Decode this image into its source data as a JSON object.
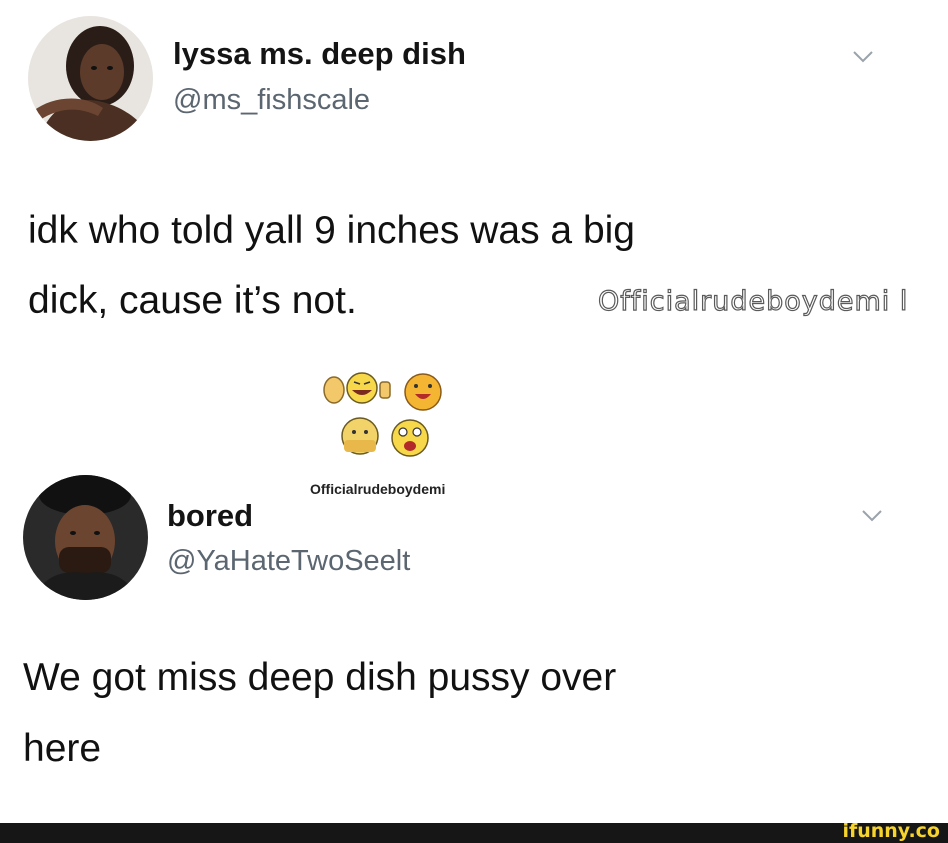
{
  "tweets": [
    {
      "display_name": "lyssa ms. deep dish",
      "handle": "@ms_fishscale",
      "text_lines": [
        "idk who told yall 9 inches was a big",
        "dick, cause it’s not."
      ]
    },
    {
      "display_name": "bored",
      "handle": "@YaHateTwoSeelt",
      "text_lines": [
        "We got miss deep dish pussy over",
        "here"
      ]
    }
  ],
  "watermarks": {
    "large": "Officialrudeboydemi l",
    "small": "Officialrudeboydemi"
  },
  "footer": {
    "brand": "ifunny.co"
  },
  "icons": {
    "chevron": "chevron-down-icon",
    "emojis": [
      "clapping-hands-emoji",
      "laughing-face-emoji",
      "thumbs-up-emoji",
      "shocked-face-emoji",
      "sweating-face-emoji",
      "screaming-face-emoji"
    ]
  },
  "colors": {
    "handle": "#5b6670",
    "brand": "#f6d32d",
    "footer_bg": "#161616"
  }
}
